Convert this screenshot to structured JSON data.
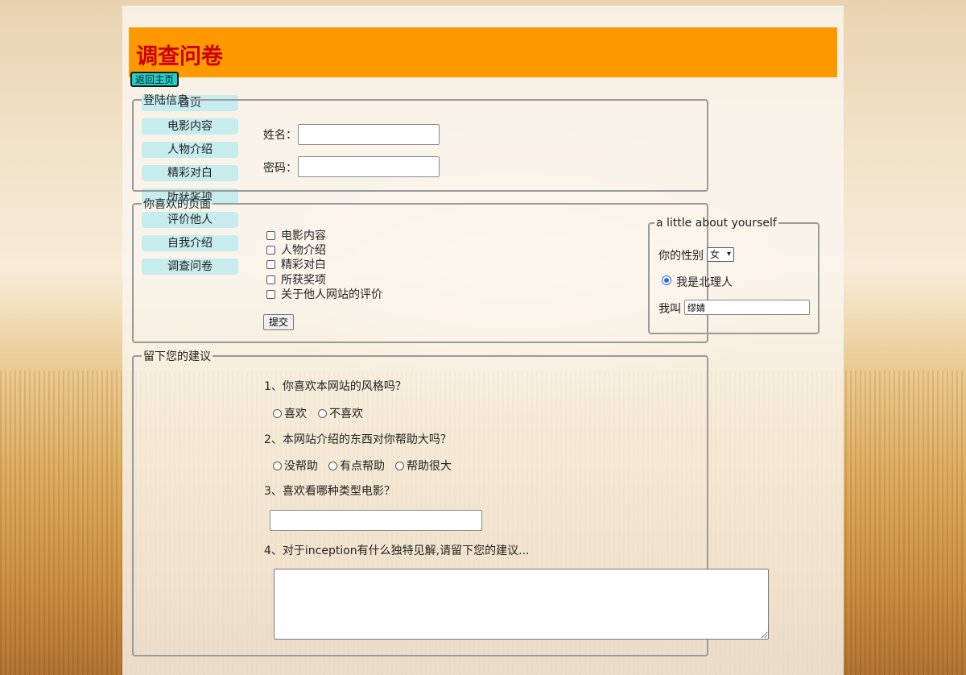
{
  "header": {
    "title": "调查问卷"
  },
  "nav": {
    "items": [
      "首页",
      "电影内容",
      "人物介绍",
      "精彩对白",
      "所获奖项",
      "评价他人",
      "自我介绍",
      "调查问卷"
    ]
  },
  "back_button": "返回主页",
  "login": {
    "legend": "登陆信息",
    "name_label": "姓名：",
    "name_value": "",
    "password_label": "密码：",
    "password_value": ""
  },
  "pages": {
    "legend": "你喜欢的页面",
    "options": [
      "电影内容",
      "人物介绍",
      "精彩对白",
      "所获奖项",
      "关于他人网站的评价"
    ],
    "submit": "提交"
  },
  "about": {
    "legend": "a little about yourself",
    "gender_label": "你的性别",
    "gender_value": "女",
    "radio_label": "我是北理人",
    "radio_checked": true,
    "name_label": "我叫",
    "name_value": "缪婧"
  },
  "suggest": {
    "legend": "留下您的建议",
    "q1": "1、你喜欢本网站的风格吗？",
    "q1_options": [
      "喜欢",
      "不喜欢"
    ],
    "q2": "2、本网站介绍的东西对你帮助大吗？",
    "q2_options": [
      "没帮助",
      "有点帮助",
      "帮助很大"
    ],
    "q3": "3、喜欢看哪种类型电影？",
    "q3_value": "",
    "q4": "4、对于inception有什么独特见解,请留下您的建议...",
    "q4_value": ""
  }
}
